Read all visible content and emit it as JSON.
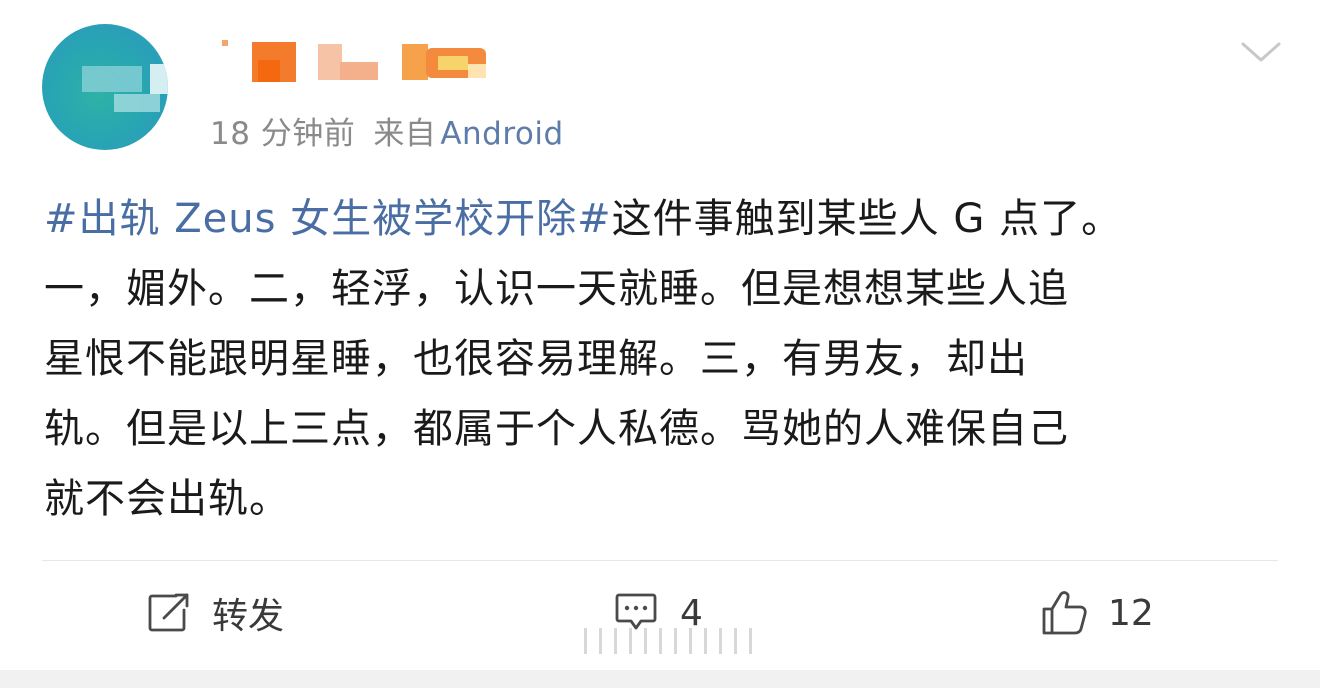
{
  "post": {
    "meta": {
      "time": "18 分钟前",
      "from_label": "来自",
      "source": "Android"
    },
    "content": {
      "hashtag": "#出轨 Zeus 女生被学校开除#",
      "lines": [
        "这件事触到某些人 G 点了。",
        "一，媚外。二，轻浮，认识一天就睡。但是想想某些人追",
        "星恨不能跟明星睡，也很容易理解。三，有男友，却出",
        "轨。但是以上三点，都属于个人私德。骂她的人难保自己",
        "就不会出轨。"
      ]
    },
    "actions": {
      "repost_label": "转发",
      "comment_count": "4",
      "like_count": "12"
    }
  },
  "icons": {
    "chevron": "chevron-down-icon",
    "repost": "repost-icon",
    "comment": "comment-icon",
    "like": "thumbs-up-icon"
  },
  "colors": {
    "link": "#4a6ea4",
    "source": "#5d7caa",
    "meta": "#8a8a8a",
    "text": "#1a1a1a"
  }
}
